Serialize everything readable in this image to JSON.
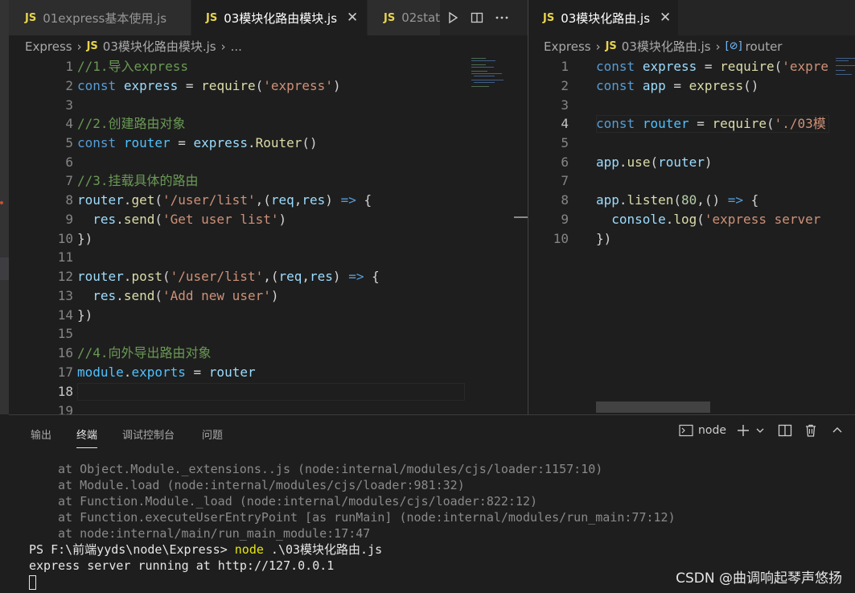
{
  "left_tabs": [
    {
      "label": "01express基本使用.js",
      "active": false
    },
    {
      "label": "03模块化路由模块.js",
      "active": true,
      "close": "✕"
    },
    {
      "label": "02stat",
      "active": false
    }
  ],
  "right_tabs": [
    {
      "label": "03模块化路由.js",
      "active": true,
      "close": "✕"
    }
  ],
  "left_breadcrumb": {
    "folder": "Express",
    "file": "03模块化路由模块.js",
    "more": "..."
  },
  "right_breadcrumb": {
    "folder": "Express",
    "file": "03模块化路由.js",
    "symbol": "router"
  },
  "js_badge": "JS",
  "left_editor": {
    "lines": [
      {
        "n": "1"
      },
      {
        "n": "2"
      },
      {
        "n": "3"
      },
      {
        "n": "4"
      },
      {
        "n": "5"
      },
      {
        "n": "6"
      },
      {
        "n": "7"
      },
      {
        "n": "8"
      },
      {
        "n": "9"
      },
      {
        "n": "10"
      },
      {
        "n": "11"
      },
      {
        "n": "12"
      },
      {
        "n": "13"
      },
      {
        "n": "14"
      },
      {
        "n": "15"
      },
      {
        "n": "16"
      },
      {
        "n": "17"
      },
      {
        "n": "18"
      },
      {
        "n": "19"
      }
    ],
    "comment1": "//1.导入express",
    "comment2": "//2.创建路由对象",
    "comment3": "//3.挂载具体的路由",
    "comment4": "//4.向外导出路由对象",
    "get_path": "'/user/list'",
    "get_msg": "'Get user list'",
    "post_path": "'/user/list'",
    "post_msg": "'Add new user'",
    "require_arg": "'express'"
  },
  "right_editor": {
    "lines": [
      {
        "n": "1"
      },
      {
        "n": "2"
      },
      {
        "n": "3"
      },
      {
        "n": "4"
      },
      {
        "n": "5"
      },
      {
        "n": "6"
      },
      {
        "n": "7"
      },
      {
        "n": "8"
      },
      {
        "n": "9"
      },
      {
        "n": "10"
      }
    ],
    "require_express": "'expre",
    "require_router": "'./03模",
    "port": "80",
    "log_msg": "'express server"
  },
  "panel": {
    "tabs": [
      {
        "label": "输出",
        "active": false
      },
      {
        "label": "终端",
        "active": true
      },
      {
        "label": "调试控制台",
        "active": false
      },
      {
        "label": "问题",
        "active": false
      }
    ],
    "shell_label": "node",
    "stack": [
      "at Object.Module._extensions..js (node:internal/modules/cjs/loader:1157:10)",
      "at Module.load (node:internal/modules/cjs/loader:981:32)",
      "at Function.Module._load (node:internal/modules/cjs/loader:822:12)",
      "at Function.executeUserEntryPoint [as runMain] (node:internal/modules/run_main:77:12)",
      "at node:internal/main/run_main_module:17:47"
    ],
    "prompt": "PS F:\\前端yyds\\node\\Express> ",
    "command": "node",
    "command_arg": " .\\03模块化路由.js",
    "output": "express server running at http://127.0.0.1"
  },
  "watermark": "CSDN @曲调响起琴声悠扬",
  "colors": {
    "keyword": "#569cd6",
    "string": "#ce9178",
    "comment": "#6a9955",
    "function": "#dcdcaa",
    "variable": "#9cdcfe",
    "js_badge": "#e8d44d"
  }
}
